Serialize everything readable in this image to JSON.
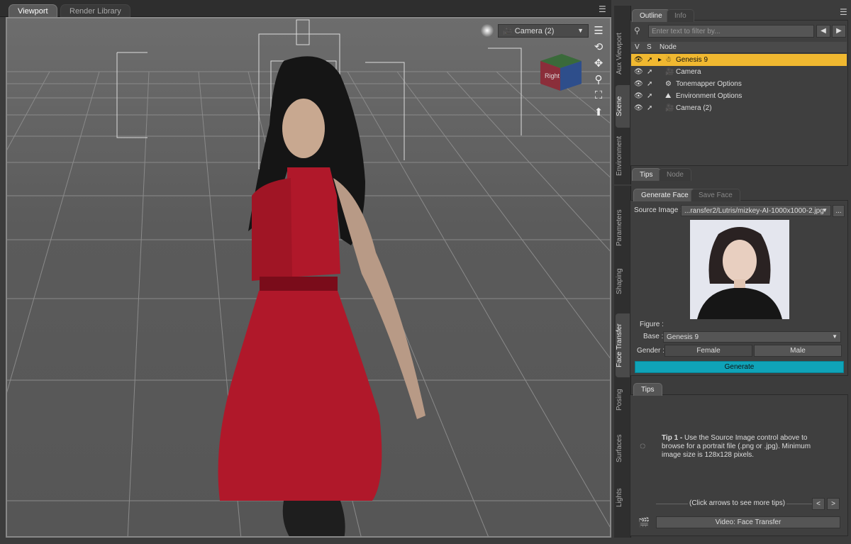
{
  "viewport_tabs": [
    "Viewport",
    "Render Library"
  ],
  "camera_select": "Camera (2)",
  "viewcube_label": "Right",
  "side_tabs_top": [
    "Aux Viewport",
    "Scene",
    "Environment"
  ],
  "side_tabs_bottom": [
    "Parameters",
    "Shaping",
    "Face Transfer",
    "Posing",
    "Surfaces",
    "Lights"
  ],
  "outline": {
    "tabs": [
      "Outline",
      "Info"
    ],
    "filter_placeholder": "Enter text to filter by...",
    "columns": {
      "v": "V",
      "s": "S",
      "node": "Node"
    },
    "rows": [
      {
        "name": "Genesis 9",
        "selected": true
      },
      {
        "name": "Camera",
        "selected": false
      },
      {
        "name": "Tonemapper Options",
        "selected": false
      },
      {
        "name": "Environment Options",
        "selected": false
      },
      {
        "name": "Camera (2)",
        "selected": false
      }
    ],
    "bottom_tabs": [
      "Tips",
      "Node"
    ]
  },
  "face_transfer": {
    "tabs": [
      "Generate Face",
      "Save Face"
    ],
    "source_label": "Source Image :",
    "source_value": "...ransfer2/Lutris/mizkey-AI-1000x1000-2.jpg",
    "browse": "...",
    "figure_label": "Figure :",
    "base_label": "Base :",
    "base_value": "Genesis 9",
    "gender_label": "Gender :",
    "gender_female": "Female",
    "gender_male": "Male",
    "generate": "Generate"
  },
  "tips": {
    "tab": "Tips",
    "title": "Tip 1 -",
    "body": "Use the Source Image control above to browse for a portrait file (.png or .jpg). Minimum image size is 128x128 pixels.",
    "nav_hint": "(Click arrows to see more tips)",
    "prev": "<",
    "next": ">",
    "video": "Video: Face Transfer"
  },
  "colors": {
    "selection": "#f0b830",
    "generate": "#0fa3b8",
    "dress": "#b0182a"
  }
}
